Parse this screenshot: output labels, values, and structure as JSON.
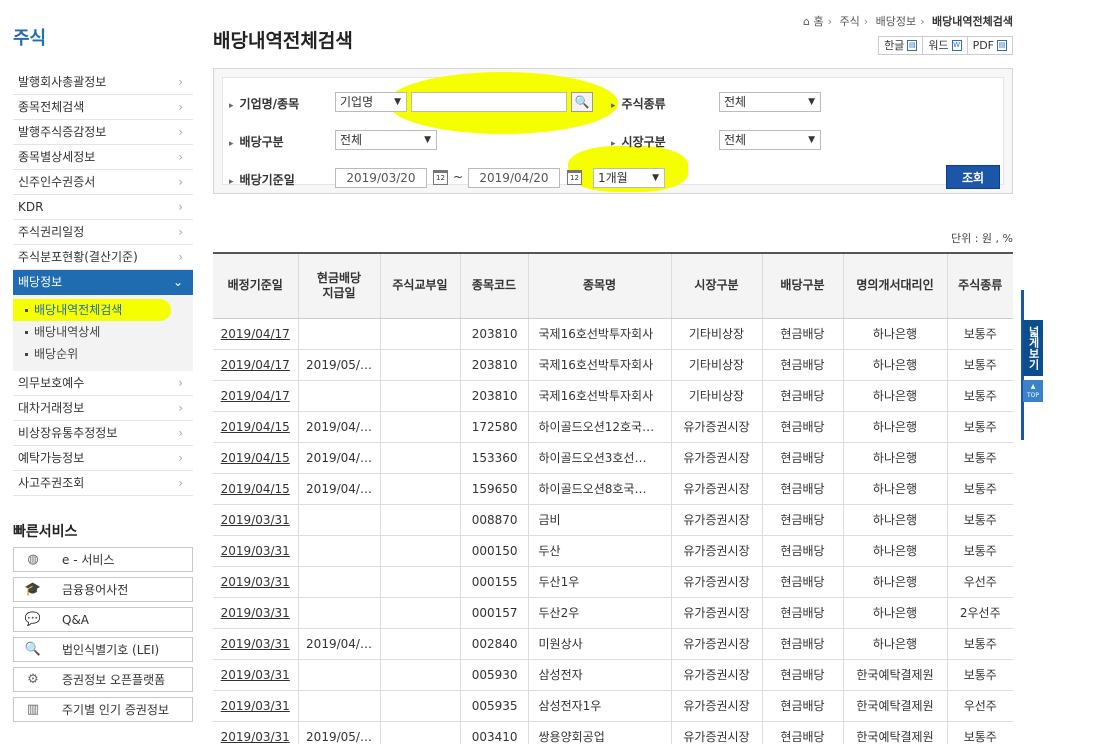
{
  "sidebar": {
    "title": "주식",
    "items": [
      {
        "label": "발행회사총괄정보"
      },
      {
        "label": "종목전체검색"
      },
      {
        "label": "발행주식증감정보"
      },
      {
        "label": "종목별상세정보"
      },
      {
        "label": "신주인수권증서"
      },
      {
        "label": "KDR"
      },
      {
        "label": "주식권리일정"
      },
      {
        "label": "주식분포현황(결산기준)"
      }
    ],
    "active_item": {
      "label": "배당정보"
    },
    "sub_items": [
      {
        "label": "배당내역전체검색"
      },
      {
        "label": "배당내역상세"
      },
      {
        "label": "배당순위"
      }
    ],
    "items_after": [
      {
        "label": "의무보호예수"
      },
      {
        "label": "대차거래정보"
      },
      {
        "label": "비상장유통추정정보"
      },
      {
        "label": "예탁가능정보"
      },
      {
        "label": "사고주권조회"
      }
    ],
    "arrow": "›",
    "active_arrow": "⌄"
  },
  "quick": {
    "title": "빠른서비스",
    "items": [
      {
        "label": "e - 서비스",
        "icon": "globe-icon"
      },
      {
        "label": "금융용어사전",
        "icon": "graduation-cap-icon"
      },
      {
        "label": "Q&A",
        "icon": "chat-icon"
      },
      {
        "label": "법인식별기호 (LEI)",
        "icon": "magnifier-doc-icon"
      },
      {
        "label": "증권정보 오픈플랫폼",
        "icon": "api-gear-icon"
      },
      {
        "label": "주기별 인기 증권정보",
        "icon": "chart-icon"
      }
    ]
  },
  "header": {
    "title": "배당내역전체검색",
    "breadcrumb": [
      "홈",
      "주식",
      "배당정보",
      "배당내역전체검색"
    ],
    "doc_buttons": [
      "한글",
      "워드",
      "PDF"
    ]
  },
  "search": {
    "company_label": "기업명/종목",
    "company_type": "기업명",
    "company_value": "",
    "stock_kind_label": "주식종류",
    "stock_kind_value": "전체",
    "dividend_kind_label": "배당구분",
    "dividend_kind_value": "전체",
    "market_label": "시장구분",
    "market_value": "전체",
    "date_label": "배당기준일",
    "date_from": "2019/03/20",
    "tilde": "~",
    "date_to": "2019/04/20",
    "period_value": "1개월",
    "lookup_label": "조회"
  },
  "unit_text": "단위 : 원 , %",
  "table": {
    "headers": [
      "배정기준일",
      "현금배당\n지급일",
      "주식교부일",
      "종목코드",
      "종목명",
      "시장구분",
      "배당구분",
      "명의개서대리인",
      "주식종류"
    ],
    "rows": [
      [
        "2019/04/17",
        "",
        "",
        "203810",
        "국제16호선박투자회사",
        "기타비상장",
        "현금배당",
        "하나은행",
        "보통주"
      ],
      [
        "2019/04/17",
        "2019/05/…",
        "",
        "203810",
        "국제16호선박투자회사",
        "기타비상장",
        "현금배당",
        "하나은행",
        "보통주"
      ],
      [
        "2019/04/17",
        "",
        "",
        "203810",
        "국제16호선박투자회사",
        "기타비상장",
        "현금배당",
        "하나은행",
        "보통주"
      ],
      [
        "2019/04/15",
        "2019/04/…",
        "",
        "172580",
        "하이골드오션12호국…",
        "유가증권시장",
        "현금배당",
        "하나은행",
        "보통주"
      ],
      [
        "2019/04/15",
        "2019/04/…",
        "",
        "153360",
        "하이골드오션3호선…",
        "유가증권시장",
        "현금배당",
        "하나은행",
        "보통주"
      ],
      [
        "2019/04/15",
        "2019/04/…",
        "",
        "159650",
        "하이골드오션8호국…",
        "유가증권시장",
        "현금배당",
        "하나은행",
        "보통주"
      ],
      [
        "2019/03/31",
        "",
        "",
        "008870",
        "금비",
        "유가증권시장",
        "현금배당",
        "하나은행",
        "보통주"
      ],
      [
        "2019/03/31",
        "",
        "",
        "000150",
        "두산",
        "유가증권시장",
        "현금배당",
        "하나은행",
        "보통주"
      ],
      [
        "2019/03/31",
        "",
        "",
        "000155",
        "두산1우",
        "유가증권시장",
        "현금배당",
        "하나은행",
        "우선주"
      ],
      [
        "2019/03/31",
        "",
        "",
        "000157",
        "두산2우",
        "유가증권시장",
        "현금배당",
        "하나은행",
        "2우선주"
      ],
      [
        "2019/03/31",
        "2019/04/…",
        "",
        "002840",
        "미원상사",
        "유가증권시장",
        "현금배당",
        "하나은행",
        "보통주"
      ],
      [
        "2019/03/31",
        "",
        "",
        "005930",
        "삼성전자",
        "유가증권시장",
        "현금배당",
        "한국예탁결제원",
        "보통주"
      ],
      [
        "2019/03/31",
        "",
        "",
        "005935",
        "삼성전자1우",
        "유가증권시장",
        "현금배당",
        "한국예탁결제원",
        "우선주"
      ],
      [
        "2019/03/31",
        "2019/05/…",
        "",
        "003410",
        "쌍용양회공업",
        "유가증권시장",
        "현금배당",
        "한국예탁결제원",
        "보통주"
      ]
    ]
  },
  "float": {
    "wide_view": "넓게보기",
    "top": "TOP"
  },
  "colors": {
    "accent": "#1f6db0",
    "button": "#1b56a8",
    "highlight": "#f6ff00"
  }
}
